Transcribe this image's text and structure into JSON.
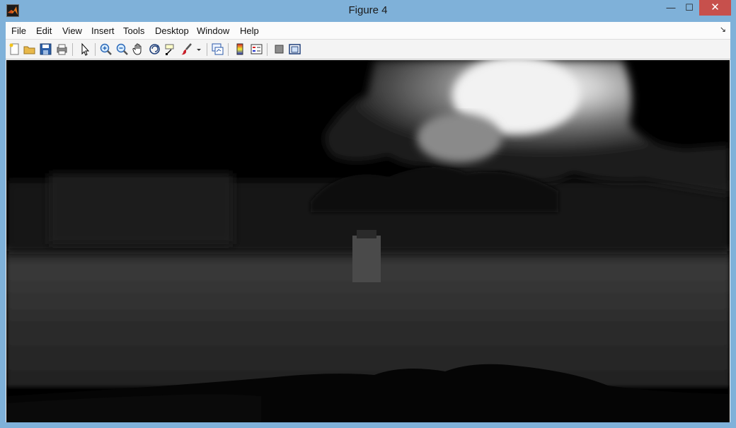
{
  "window": {
    "title": "Figure 4",
    "minimize_glyph": "—",
    "maximize_glyph": "☐",
    "close_glyph": "✕"
  },
  "menubar": {
    "items": [
      "File",
      "Edit",
      "View",
      "Insert",
      "Tools",
      "Desktop",
      "Window",
      "Help"
    ],
    "dock_glyph": "↘"
  },
  "toolbar": {
    "tools": [
      "new-figure-icon",
      "open-file-icon",
      "save-icon",
      "print-icon",
      "edit-plot-arrow-icon",
      "zoom-in-icon",
      "zoom-out-icon",
      "pan-hand-icon",
      "rotate-3d-icon",
      "data-cursor-icon",
      "brush-icon",
      "brush-dropdown-icon",
      "link-plot-icon",
      "insert-colorbar-icon",
      "insert-legend-icon",
      "hide-plot-tools-icon",
      "show-plot-tools-icon"
    ]
  },
  "colors": {
    "title_bar": "#7fb1d9",
    "close_button": "#c7504c",
    "canvas_background": "#000000"
  }
}
